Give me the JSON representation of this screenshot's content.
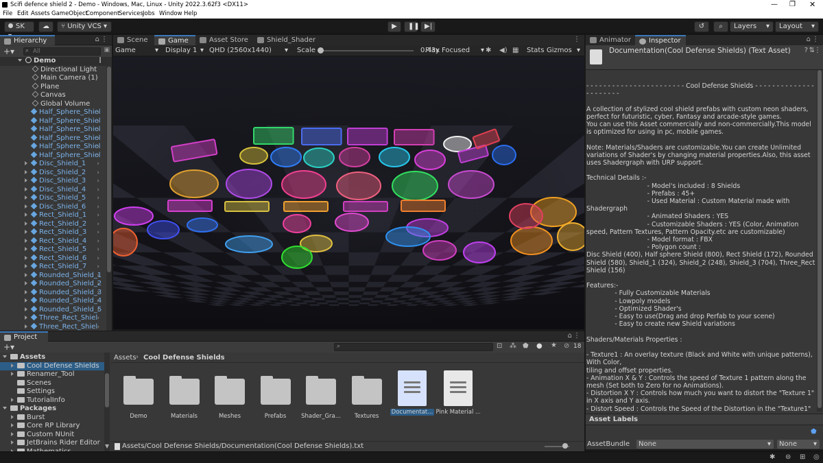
{
  "window": {
    "title": "Scifi defence shield 2 - Demo - Windows, Mac, Linux - Unity 2022.3.62f3 <DX11>"
  },
  "menu": [
    "File",
    "Edit",
    "Assets",
    "GameObject",
    "Component",
    "Services",
    "Jobs",
    "Window",
    "Help"
  ],
  "toolbar": {
    "account": "SK",
    "vcs": "Unity VCS",
    "layers": "Layers",
    "layout": "Layout"
  },
  "hierarchy": {
    "tab": "Hierarchy",
    "search_placeholder": "All",
    "scene": "Demo",
    "items": [
      "Directional Light",
      "Main Camera (1)",
      "Plane",
      "Canvas",
      "Global Volume"
    ],
    "prefabs": [
      "Half_Sphere_Shiel",
      "Half_Sphere_Shiel",
      "Half_Sphere_Shiel",
      "Half_Sphere_Shiel",
      "Half_Sphere_Shiel",
      "Half_Sphere_Shiel",
      "Disc_Shield_1",
      "Disc_Shield_2",
      "Disc_Shield_3",
      "Disc_Shield_4",
      "Disc_Shield_5",
      "Disc_Shield_6",
      "Rect_Shield_1",
      "Rect_Shield_2",
      "Rect_Shield_3",
      "Rect_Shield_4",
      "Rect_Shield_5",
      "Rect_Shield_6",
      "Rect_Shield_7",
      "Rounded_Shield_1",
      "Rounded_Shield_2",
      "Rounded_Shield_3",
      "Rounded_Shield_4",
      "Rounded_Shield_5",
      "Three_Rect_Shiel",
      "Three_Rect_Shiel"
    ]
  },
  "center_tabs": [
    "Scene",
    "Game",
    "Asset Store",
    "Shield_Shader"
  ],
  "gamebar": {
    "mode": "Game",
    "display": "Display 1",
    "resolution": "QHD (2560x1440)",
    "scale_label": "Scale",
    "scale_value": "0.43x",
    "play_focused": "Play Focused",
    "stats": "Stats",
    "gizmos": "Gizmos"
  },
  "right_tabs": [
    "Animator",
    "Inspector"
  ],
  "inspector": {
    "title": "Documentation(Cool Defense Shields) (Text Asset)",
    "text": "- - - - - - - - - - - - - - - - - - - - - - - Cool Defense Shields - - - - - - - - - - - - - - - - - - - - - -\n\nA collection of stylized cool shield prefabs with custom neon shaders, perfect for futuristic, cyber, Fantasy and arcade-style games.\nYou can use this Asset commercially and non-commercially.This model is optimized for using in pc, mobile games.\n\nNote: Materials/Shaders are customizable.You can create Unlimited variations of Shader's by changing material properties.Also, this asset uses Shadergraph with URP support.\n\nTechnical Details :-\n                              - Model's included : 8 Shields\n                              - Prefabs : 45+\n                              - Used Material : Custom Material made with Shadergraph\n                              - Animated Shaders : YES\n                              - Customizable Shaders : YES (Color, Animation speed, Pattern Textures, Pattern Opacity.etc are customizable)\n                              - Model format : FBX\n                              - Polygon count :\nDisc Shield (400), Half sphere Shield (800), Rect Shield (172), Rounded Shield (580), Shield_1 (324), Shield_2 (248), Shield_3 (704), Three_Rect Shield (156)\n\nFeatures:-\n              - Fully Customizable Materials\n              - Lowpoly models\n              - Optimized Shader's\n              - Easy to use(Drag and drop Perfab to your scene)\n              - Easy to create new Shield variations\n\nShaders/Materials Properties :\n\n- Texture1 : An overlay texture (Black and White with unique patterns), With Color,\ntiling and offset properties.\n- Animation X & Y : Controls the speed of Texture 1 pattern along the mesh (Set both to Zero for no Animations).\n- Distortion X Y : Controls how much you want to distort the \"Texture 1\" in X axis and Y axis.\n- Distort Speed : Controls the Speed of the Distortion in the \"Texture1\"",
    "asset_labels": "Asset Labels",
    "assetbundle_label": "AssetBundle",
    "assetbundle_value": "None",
    "variant_value": "None"
  },
  "project": {
    "tab": "Project",
    "count": "18",
    "tree": [
      {
        "label": "Assets",
        "level": 0,
        "kind": "root"
      },
      {
        "label": "Cool Defense Shields",
        "level": 1,
        "sel": true
      },
      {
        "label": "Renamer_Tool",
        "level": 1
      },
      {
        "label": "Scenes",
        "level": 1
      },
      {
        "label": "Settings",
        "level": 1
      },
      {
        "label": "TutorialInfo",
        "level": 1
      },
      {
        "label": "Packages",
        "level": 0,
        "kind": "root"
      },
      {
        "label": "Burst",
        "level": 1
      },
      {
        "label": "Core RP Library",
        "level": 1
      },
      {
        "label": "Custom NUnit",
        "level": 1
      },
      {
        "label": "JetBrains Rider Editor",
        "level": 1
      },
      {
        "label": "Mathematics",
        "level": 1
      }
    ],
    "breadcrumb": [
      "Assets",
      "Cool Defense Shields"
    ],
    "assets": [
      {
        "label": "Demo",
        "kind": "folder"
      },
      {
        "label": "Materials",
        "kind": "folder"
      },
      {
        "label": "Meshes",
        "kind": "folder"
      },
      {
        "label": "Prefabs",
        "kind": "folder"
      },
      {
        "label": "Shader_Gra...",
        "kind": "folder"
      },
      {
        "label": "Textures",
        "kind": "folder"
      },
      {
        "label": "Documentat...",
        "kind": "doc",
        "sel": true
      },
      {
        "label": "Pink Material ...",
        "kind": "doc"
      }
    ],
    "path": "Assets/Cool Defense Shields/Documentation(Cool Defense Shields).txt"
  }
}
